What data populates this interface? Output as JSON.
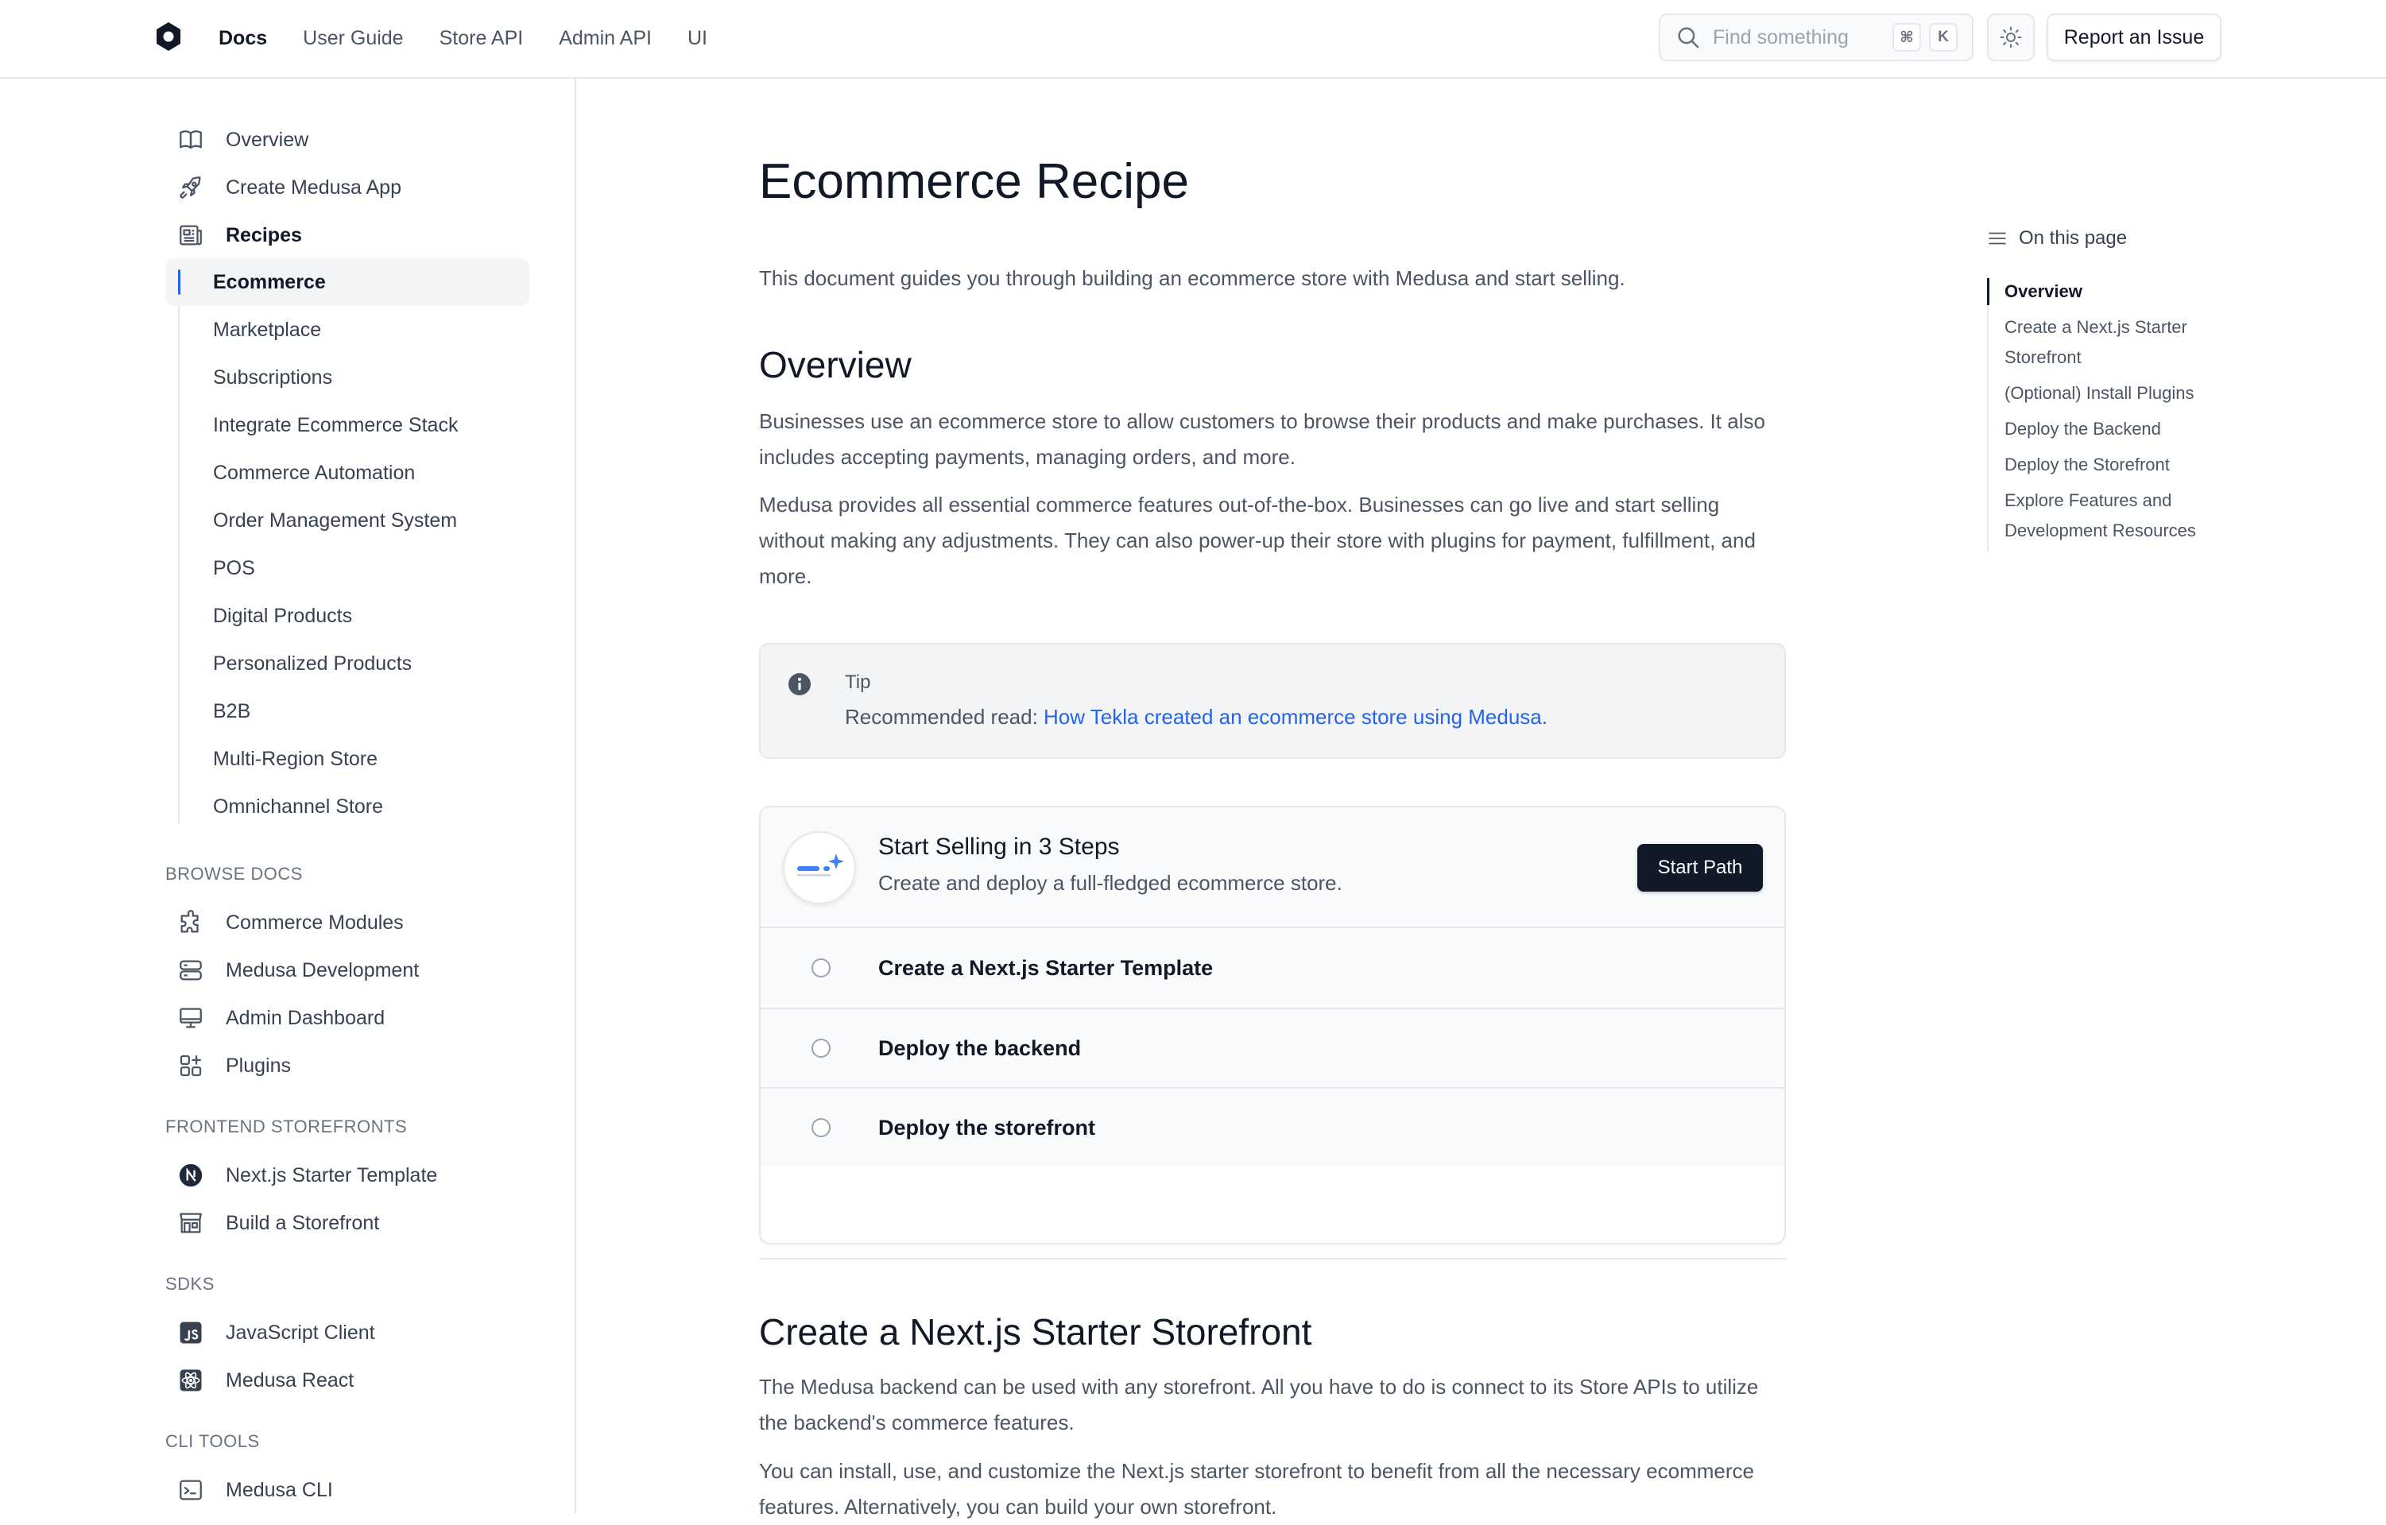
{
  "topnav": {
    "links": [
      "Docs",
      "User Guide",
      "Store API",
      "Admin API",
      "UI"
    ],
    "search_placeholder": "Find something",
    "shortcut_keys": [
      "⌘",
      "K"
    ],
    "report_label": "Report an Issue"
  },
  "sidebar": {
    "top_items": [
      {
        "label": "Overview",
        "icon": "book-icon"
      },
      {
        "label": "Create Medusa App",
        "icon": "rocket-icon"
      },
      {
        "label": "Recipes",
        "icon": "newspaper-icon"
      }
    ],
    "recipes": [
      "Ecommerce",
      "Marketplace",
      "Subscriptions",
      "Integrate Ecommerce Stack",
      "Commerce Automation",
      "Order Management System",
      "POS",
      "Digital Products",
      "Personalized Products",
      "B2B",
      "Multi-Region Store",
      "Omnichannel Store"
    ],
    "active_recipe": "Ecommerce",
    "sections": [
      {
        "title": "BROWSE DOCS",
        "items": [
          {
            "label": "Commerce Modules",
            "icon": "puzzle-icon"
          },
          {
            "label": "Medusa Development",
            "icon": "server-icon"
          },
          {
            "label": "Admin Dashboard",
            "icon": "monitor-icon"
          },
          {
            "label": "Plugins",
            "icon": "squares-plus-icon"
          }
        ]
      },
      {
        "title": "FRONTEND STOREFRONTS",
        "items": [
          {
            "label": "Next.js Starter Template",
            "icon": "nextjs-icon"
          },
          {
            "label": "Build a Storefront",
            "icon": "storefront-icon"
          }
        ]
      },
      {
        "title": "SDKS",
        "items": [
          {
            "label": "JavaScript Client",
            "icon": "javascript-icon"
          },
          {
            "label": "Medusa React",
            "icon": "react-icon"
          }
        ]
      },
      {
        "title": "CLI TOOLS",
        "items": [
          {
            "label": "Medusa CLI",
            "icon": "terminal-icon"
          }
        ]
      }
    ]
  },
  "main": {
    "title": "Ecommerce Recipe",
    "intro": "This document guides you through building an ecommerce store with Medusa and start selling.",
    "overview_heading": "Overview",
    "overview_p1": "Businesses use an ecommerce store to allow customers to browse their products and make purchases. It also includes accepting payments, managing orders, and more.",
    "overview_p2": "Medusa provides all essential commerce features out-of-the-box. Businesses can go live and start selling without making any adjustments. They can also power-up their store with plugins for payment, fulfillment, and more.",
    "tip": {
      "title": "Tip",
      "prefix": "Recommended read: ",
      "link": "How Tekla created an ecommerce store using Medusa",
      "suffix": "."
    },
    "card": {
      "title": "Start Selling in 3 Steps",
      "subtitle": "Create and deploy a full-fledged ecommerce store.",
      "button": "Start Path",
      "steps": [
        "Create a Next.js Starter Template",
        "Deploy the backend",
        "Deploy the storefront"
      ]
    },
    "section2_heading": "Create a Next.js Starter Storefront",
    "section2_p1": "The Medusa backend can be used with any storefront. All you have to do is connect to its Store APIs to utilize the backend's commerce features.",
    "section2_p2": "You can install, use, and customize the Next.js starter storefront to benefit from all the necessary ecommerce features. Alternatively, you can build your own storefront."
  },
  "toc": {
    "title": "On this page",
    "items": [
      "Overview",
      "Create a Next.js Starter Storefront",
      "(Optional) Install Plugins",
      "Deploy the Backend",
      "Deploy the Storefront",
      "Explore Features and Development Resources"
    ],
    "active": "Overview"
  },
  "colors": {
    "accent": "#2563eb",
    "text": "#111827",
    "muted": "#4b5563",
    "border": "#e5e7eb",
    "button_dark": "#111827"
  }
}
